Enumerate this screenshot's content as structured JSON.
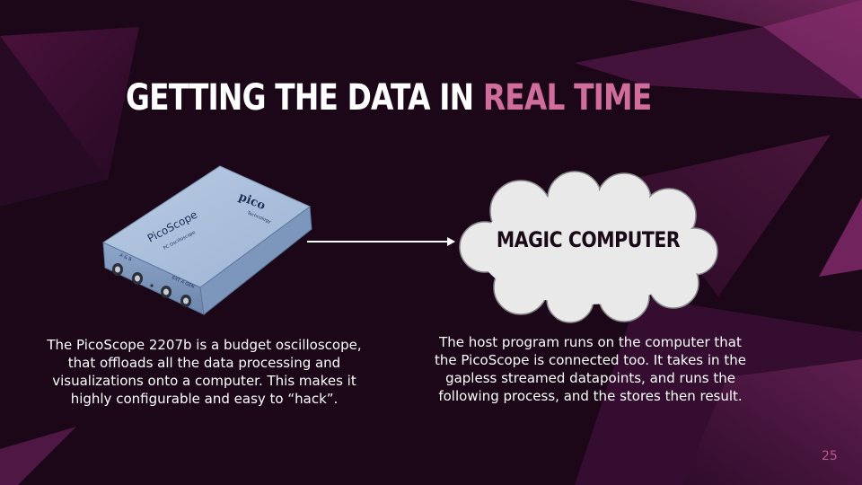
{
  "slide": {
    "title_part1": "GETTING THE DATA IN ",
    "title_part2": "REAL TIME",
    "cloud_label": "MAGIC COMPUTER",
    "left_caption": "The PicoScope 2207b is a budget oscilloscope,\nthat offloads all the data processing and\nvisualizations onto a computer. This makes it\nhighly configurable and easy to “hack”.",
    "right_caption": "The host program runs on the computer that\nthe PicoScope is connected too. It takes in the\ngapless streamed datapoints, and runs the\nfollowing process, and the stores then result.",
    "page_number": "25"
  },
  "device": {
    "brand": "pico",
    "brand_sub": "Technology",
    "product": "PicoScope",
    "product_sub": "PC Oscilloscope",
    "port_label_a": "A & B",
    "port_label_b": "EXT A GEN"
  },
  "colors": {
    "background": "#1b0718",
    "accent": "#d06d9d",
    "title": "#ffffff",
    "cloud_fill": "#e9e9ea",
    "page_number": "#b55a8c"
  }
}
